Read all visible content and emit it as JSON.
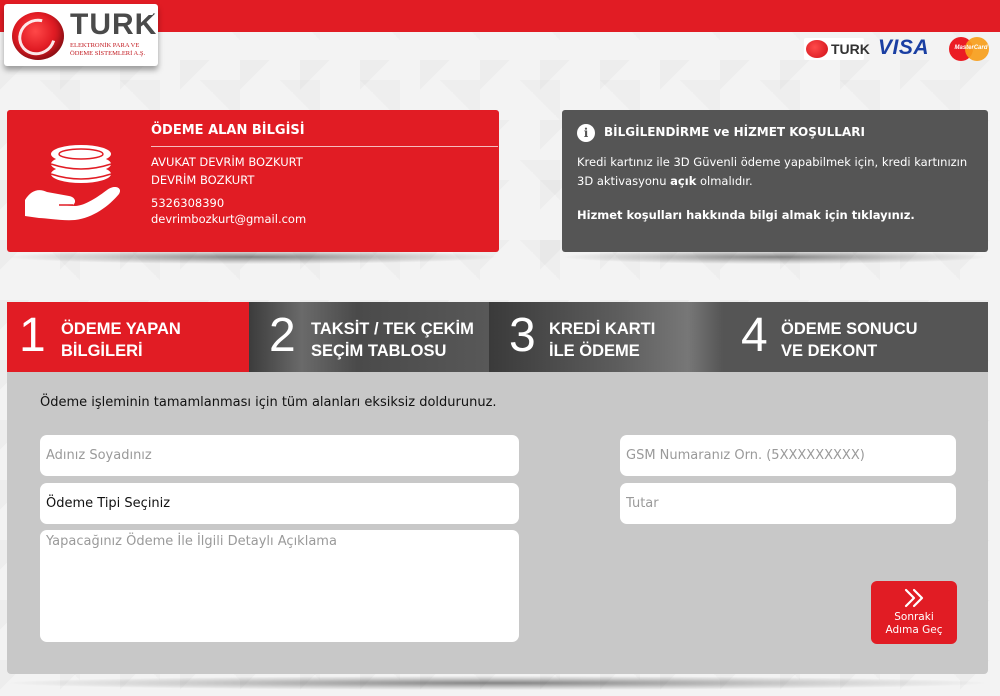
{
  "header": {
    "logo_word": "TURK",
    "logo_sub": "ELEKTRONİK PARA VE ÖDEME SİSTEMLERİ A.Ş.",
    "brands": {
      "turk": "TURK",
      "visa": "VISA",
      "mastercard": "MasterCard"
    },
    "colors": {
      "brand_red": "#e11c24",
      "dark_gray": "#555555"
    }
  },
  "payee": {
    "title": "ÖDEME ALAN BİLGİSİ",
    "company": "AVUKAT DEVRİM BOZKURT",
    "name": "DEVRİM BOZKURT",
    "phone": "5326308390",
    "email": "devrimbozkurt@gmail.com"
  },
  "info": {
    "title": "BİLGİLENDİRME ve HİZMET KOŞULLARI",
    "text_before": "Kredi kartınız ile 3D Güvenli ödeme yapabilmek için, kredi kartınızın 3D aktivasyonu ",
    "text_bold": "açık",
    "text_after": " olmalıdır.",
    "link": "Hizmet koşulları hakkında bilgi almak için tıklayınız."
  },
  "steps": [
    {
      "number": "1",
      "label": "ÖDEME YAPAN\nBİLGİLERİ"
    },
    {
      "number": "2",
      "label": "TAKSİT / TEK ÇEKİM\nSEÇİM TABLOSU"
    },
    {
      "number": "3",
      "label": "KREDİ KARTI\nİLE ÖDEME"
    },
    {
      "number": "4",
      "label": "ÖDEME SONUCU\nVE DEKONT"
    }
  ],
  "form": {
    "intro": "Ödeme işleminin tamamlanması için tüm alanları eksiksiz doldurunuz.",
    "name_placeholder": "Adınız Soyadınız",
    "payment_type_value": "Ödeme Tipi Seçiniz",
    "description_placeholder": "Yapacağınız Ödeme İle İlgili Detaylı Açıklama",
    "gsm_placeholder": "GSM Numaranız Örn. (5XXXXXXXXX)",
    "amount_placeholder": "Tutar",
    "next_label": "Sonraki\nAdıma Geç"
  }
}
